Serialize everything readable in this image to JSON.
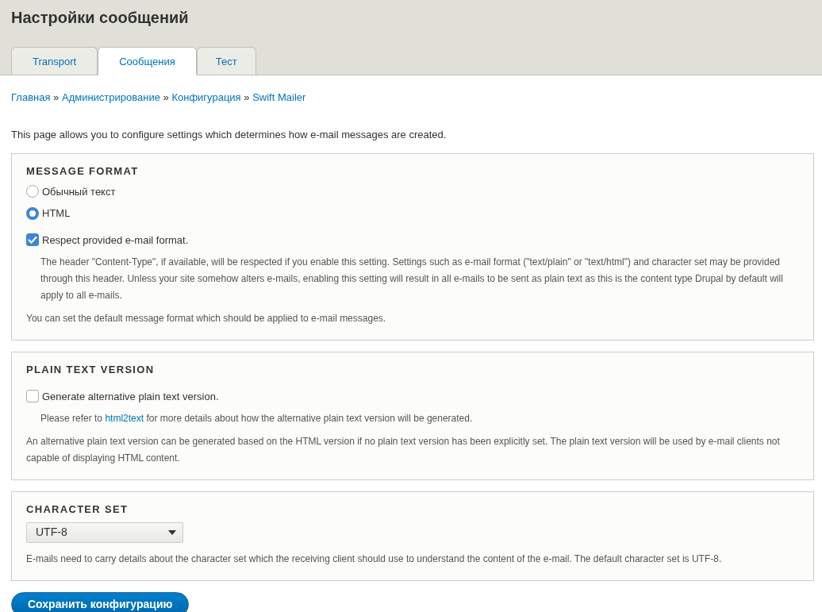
{
  "page_title": "Настройки сообщений",
  "tabs": [
    {
      "label": "Transport",
      "selected": false
    },
    {
      "label": "Сообщения",
      "selected": true
    },
    {
      "label": "Тест",
      "selected": false
    }
  ],
  "breadcrumb": [
    "Главная",
    "Администрирование",
    "Конфигурация",
    "Swift Mailer"
  ],
  "breadcrumb_separator": "»",
  "intro": "This page allows you to configure settings which determines how e-mail messages are created.",
  "fieldsets": [
    {
      "legend": "MESSAGE FORMAT",
      "items": [
        {
          "kind": "radio",
          "label": "Обычный текст",
          "selected": false
        },
        {
          "kind": "radio",
          "label": "HTML",
          "selected": true
        },
        {
          "kind": "checkbox",
          "label": "Respect provided e-mail format.",
          "checked": true,
          "description": [
            {
              "kind": "text",
              "text": "The header \"Content-Type\", if available, will be respected if you enable this setting. Settings such as e-mail format (\"text/plain\" or \"text/html\") and character set may be provided through this header. Unless your site somehow alters e-mails, enabling this setting will result in all e-mails to be sent as plain text as this is the content type Drupal by default will apply to all e-mails."
            }
          ]
        }
      ],
      "description": "You can set the default message format which should be applied to e-mail messages."
    },
    {
      "legend": "PLAIN TEXT VERSION",
      "items": [
        {
          "kind": "checkbox",
          "label": "Generate alternative plain text version.",
          "checked": false,
          "description": [
            {
              "kind": "text",
              "text": "Please refer to "
            },
            {
              "kind": "link",
              "text": "html2text"
            },
            {
              "kind": "text",
              "text": " for more details about how the alternative plain text version will be generated."
            }
          ]
        }
      ],
      "description": "An alternative plain text version can be generated based on the HTML version if no plain text version has been explicitly set. The plain text version will be used by e-mail clients not capable of displaying HTML content."
    },
    {
      "legend": "CHARACTER SET",
      "items": [
        {
          "kind": "select",
          "value": "UTF-8"
        }
      ],
      "description": "E-mails need to carry details about the character set which the receiving client should use to understand the content of the e-mail. The default character set is UTF-8."
    }
  ],
  "save_button": "Сохранить конфигурацию"
}
